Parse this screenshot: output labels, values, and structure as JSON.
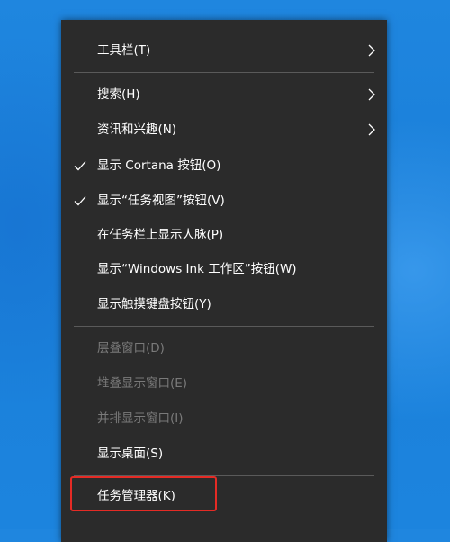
{
  "menu": {
    "items": [
      {
        "label": "工具栏(T)",
        "submenu": true,
        "checked": false,
        "disabled": false
      },
      {
        "label": "搜索(H)",
        "submenu": true,
        "checked": false,
        "disabled": false
      },
      {
        "label": "资讯和兴趣(N)",
        "submenu": true,
        "checked": false,
        "disabled": false
      },
      {
        "label": "显示 Cortana 按钮(O)",
        "submenu": false,
        "checked": true,
        "disabled": false
      },
      {
        "label": "显示“任务视图”按钮(V)",
        "submenu": false,
        "checked": true,
        "disabled": false
      },
      {
        "label": "在任务栏上显示人脉(P)",
        "submenu": false,
        "checked": false,
        "disabled": false
      },
      {
        "label": "显示“Windows Ink 工作区”按钮(W)",
        "submenu": false,
        "checked": false,
        "disabled": false
      },
      {
        "label": "显示触摸键盘按钮(Y)",
        "submenu": false,
        "checked": false,
        "disabled": false
      },
      {
        "label": "层叠窗口(D)",
        "submenu": false,
        "checked": false,
        "disabled": true
      },
      {
        "label": "堆叠显示窗口(E)",
        "submenu": false,
        "checked": false,
        "disabled": true
      },
      {
        "label": "并排显示窗口(I)",
        "submenu": false,
        "checked": false,
        "disabled": true
      },
      {
        "label": "显示桌面(S)",
        "submenu": false,
        "checked": false,
        "disabled": false
      },
      {
        "label": "任务管理器(K)",
        "submenu": false,
        "checked": false,
        "disabled": false,
        "highlighted": true
      }
    ]
  },
  "colors": {
    "menu_background": "#2b2b2b",
    "text": "#ffffff",
    "disabled_text": "#7a7a7a",
    "separator": "#5a5a5a",
    "highlight_box": "#e52b25",
    "desktop": "#1f86df"
  },
  "icons": {
    "check": "checkmark-icon",
    "submenu": "chevron-right-icon"
  }
}
